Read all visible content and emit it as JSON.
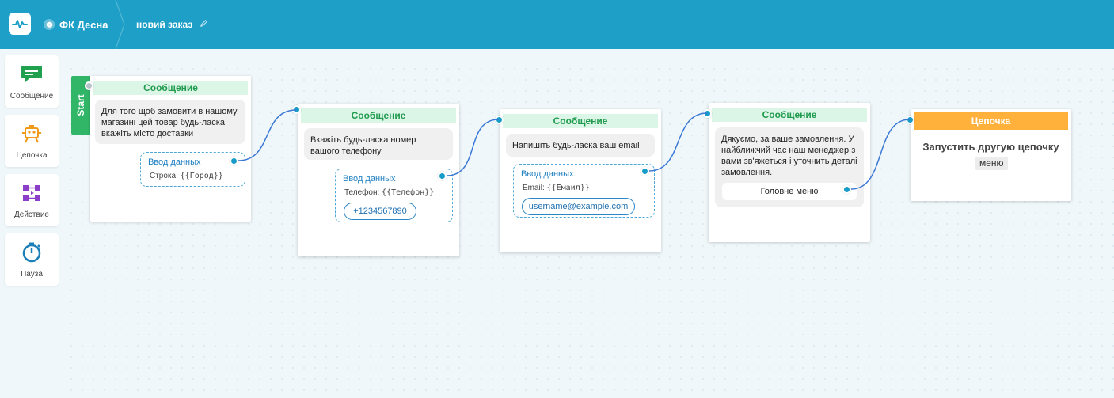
{
  "header": {
    "bot_name": "ФК Десна",
    "flow_name": "новий заказ"
  },
  "toolbar": {
    "items": [
      {
        "label": "Сообщение",
        "icon": "message-icon",
        "color": "#1fa14e"
      },
      {
        "label": "Цепочка",
        "icon": "chain-icon",
        "color": "#f09a1a"
      },
      {
        "label": "Действие",
        "icon": "action-icon",
        "color": "#8b3fc9"
      },
      {
        "label": "Пауза",
        "icon": "timer-icon",
        "color": "#1c7fb8"
      }
    ]
  },
  "start_label": "Start",
  "nodes": [
    {
      "header": "Сообщение",
      "text": "Для того щоб замовити в нашому магазині цей товар будь-ласка вкажіть місто доставки",
      "input": {
        "title": "Ввод данных",
        "label": "Строка:",
        "variable": "{{Город}}"
      }
    },
    {
      "header": "Сообщение",
      "text": "Вкажіть будь-ласка номер вашого телефону",
      "input": {
        "title": "Ввод данных",
        "label": "Телефон:",
        "variable": "{{Телефон}}",
        "example": "+1234567890"
      }
    },
    {
      "header": "Сообщение",
      "text": "Напишіть будь-ласка ваш email",
      "input": {
        "title": "Ввод данных",
        "label": "Email:",
        "variable": "{{Емаил}}",
        "example": "username@example.com"
      }
    },
    {
      "header": "Сообщение",
      "text": "Дякуємо, за ваше замовлення. У найближчий час наш менеджер з вами зв'яжеться і уточнить деталі замовлення.",
      "button": "Головне меню"
    }
  ],
  "chain_node": {
    "header": "Цепочка",
    "title": "Запустить другую цепочку",
    "tag": "меню"
  },
  "colors": {
    "topbar": "#1d9fc7",
    "message_header_bg": "#dbf5e6",
    "message_header_text": "#1f9b4d",
    "chain_header": "#ffb13c",
    "start_tab": "#31b668",
    "connector": "#179cc8"
  }
}
